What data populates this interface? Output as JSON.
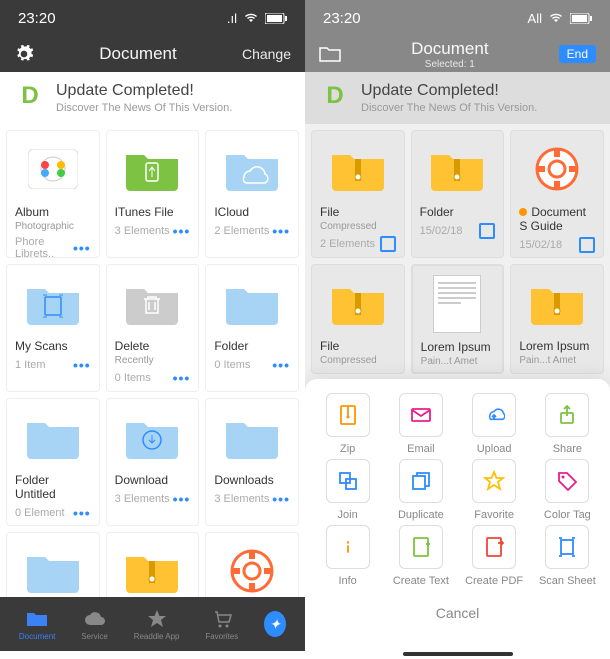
{
  "left": {
    "time": "23:20",
    "signal": ".ıl",
    "header_title": "Document",
    "header_right": "Change",
    "banner": {
      "t1": "Update Completed!",
      "t2": "Discover The News Of This Version."
    },
    "cells": [
      {
        "title": "Album",
        "sub": "Photographic",
        "count": "Phore Librets..",
        "icon": "album"
      },
      {
        "title": "ITunes File",
        "sub": "",
        "count": "3 Elements",
        "icon": "usb"
      },
      {
        "title": "ICloud",
        "sub": "",
        "count": "2 Elements",
        "icon": "cloud"
      },
      {
        "title": "My Scans",
        "sub": "",
        "count": "1 Item",
        "icon": "scan"
      },
      {
        "title": "Delete",
        "sub": "Recently",
        "count": "0 Items",
        "icon": "trash"
      },
      {
        "title": "Folder",
        "sub": "",
        "count": "0 Items",
        "icon": "folder"
      },
      {
        "title": "Folder Untitled",
        "sub": "",
        "count": "0 Element",
        "icon": "folder"
      },
      {
        "title": "Download",
        "sub": "",
        "count": "3 Elements",
        "icon": "download"
      },
      {
        "title": "Downloads",
        "sub": "",
        "count": "3 Elements",
        "icon": "folder"
      }
    ],
    "row4": [
      {
        "icon": "folder"
      },
      {
        "icon": "zip"
      },
      {
        "icon": "lifebuoy"
      }
    ],
    "tabs": [
      {
        "label": "Document",
        "icon": "folder",
        "active": true
      },
      {
        "label": "Service",
        "icon": "cloud",
        "active": false
      },
      {
        "label": "Readdle App",
        "icon": "star",
        "active": false
      },
      {
        "label": "Favorites",
        "icon": "cart",
        "active": false
      },
      {
        "label": "",
        "icon": "compass",
        "active": false
      }
    ]
  },
  "right": {
    "time": "23:20",
    "signal_text": "All",
    "header_title": "Document",
    "header_sub": "Selected: 1",
    "header_right": "End",
    "banner": {
      "t1": "Update Completed!",
      "t2": "Discover The News Of This Version."
    },
    "cells": [
      {
        "title": "File",
        "sub": "Compressed",
        "count": "2 Elements",
        "icon": "zip",
        "check": true
      },
      {
        "title": "Folder",
        "sub": "",
        "count": "15/02/18",
        "icon": "zip",
        "check": true
      },
      {
        "title": "Document S Guide",
        "sub": "",
        "count": "15/02/18",
        "icon": "lifebuoy",
        "check": true,
        "dot": true
      },
      {
        "title": "File",
        "sub": "Compressed",
        "count": "",
        "icon": "zip"
      },
      {
        "title": "Lorem Ipsum",
        "sub": "Pain...t Amet",
        "count": "",
        "icon": "doc",
        "selected": true
      },
      {
        "title": "Lorem Ipsum",
        "sub": "Pain...t Amet",
        "count": "",
        "icon": "zip"
      }
    ],
    "actions": [
      {
        "label": "Zip",
        "icon": "zip-action",
        "color": "#ff9500"
      },
      {
        "label": "Email",
        "icon": "email",
        "color": "#e91e8c"
      },
      {
        "label": "Upload",
        "icon": "upload",
        "color": "#2d8cff"
      },
      {
        "label": "Share",
        "icon": "share",
        "color": "#7dc242"
      },
      {
        "label": "Join",
        "icon": "join",
        "color": "#2d8cff"
      },
      {
        "label": "Duplicate",
        "icon": "duplicate",
        "color": "#2d8cff"
      },
      {
        "label": "Favorite",
        "icon": "favorite",
        "color": "#ffc107"
      },
      {
        "label": "Color Tag",
        "icon": "tag",
        "color": "#e91e8c"
      },
      {
        "label": "Info",
        "icon": "info",
        "color": "#ff9500"
      },
      {
        "label": "Create Text",
        "icon": "create-text",
        "color": "#7dc242"
      },
      {
        "label": "Create PDF",
        "icon": "create-pdf",
        "color": "#f44336"
      },
      {
        "label": "Scan Sheet",
        "icon": "scan-sheet",
        "color": "#2d8cff"
      }
    ],
    "cancel": "Cancel"
  }
}
